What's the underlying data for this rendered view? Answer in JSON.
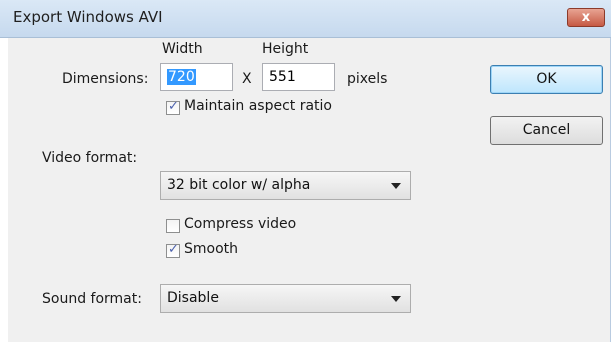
{
  "window": {
    "title": "Export Windows AVI",
    "close_label": "x"
  },
  "dimensions": {
    "label": "Dimensions:",
    "width_header": "Width",
    "height_header": "Height",
    "width_value": "720",
    "separator": "X",
    "height_value": "551",
    "unit": "pixels",
    "maintain_aspect_label": "Maintain aspect ratio",
    "maintain_aspect_checked": true
  },
  "video": {
    "label": "Video format:",
    "selected": "32 bit color  w/ alpha",
    "compress_label": "Compress video",
    "compress_checked": false,
    "smooth_label": "Smooth",
    "smooth_checked": true
  },
  "sound": {
    "label": "Sound format:",
    "selected": "Disable"
  },
  "buttons": {
    "ok": "OK",
    "cancel": "Cancel"
  },
  "icons": {
    "check": "check-icon",
    "dropdown": "chevron-down-icon",
    "close": "close-icon"
  },
  "colors": {
    "selection": "#3399ff",
    "client_bg": "#f0f0f0",
    "titlebar": "#dae8f6",
    "close": "#c65a44"
  }
}
